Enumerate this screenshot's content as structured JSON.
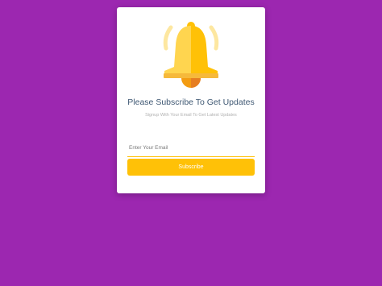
{
  "card": {
    "title": "Please Subscribe To Get Updates",
    "subtitle": "Signup With Your Email To Get Latest Updates",
    "email_placeholder": "Enter Your Email",
    "email_value": "",
    "subscribe_label": "Subscribe",
    "icon": "bell-icon"
  },
  "colors": {
    "background": "#9c27b0",
    "accent": "#ffc107",
    "title": "#3f5873"
  }
}
